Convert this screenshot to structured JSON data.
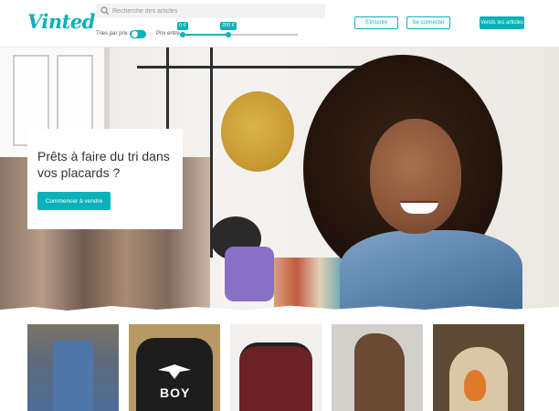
{
  "header": {
    "logo": "Vinted",
    "search_placeholder": "Recherche des articles",
    "sort_label": "Tries par prix :",
    "price_label": "Prix entre :",
    "price_min_tip": "0 €",
    "price_max_tip": "200 €",
    "price_range_fraction": [
      0,
      0.41
    ],
    "signup_label": "S'inscrire",
    "login_label": "Se connecter",
    "sell_label": "Vends tes articles"
  },
  "hero": {
    "title": "Prêts à faire du tri dans vos placards ?",
    "cta_label": "Commencer à vendre"
  },
  "products": [
    {
      "name": "denim-overalls"
    },
    {
      "name": "boy-london-sweater",
      "print": "BOY"
    },
    {
      "name": "burgundy-knit-sweater"
    },
    {
      "name": "brown-leather-boots"
    },
    {
      "name": "fox-print-backpack"
    }
  ],
  "colors": {
    "accent": "#09b1ba"
  }
}
